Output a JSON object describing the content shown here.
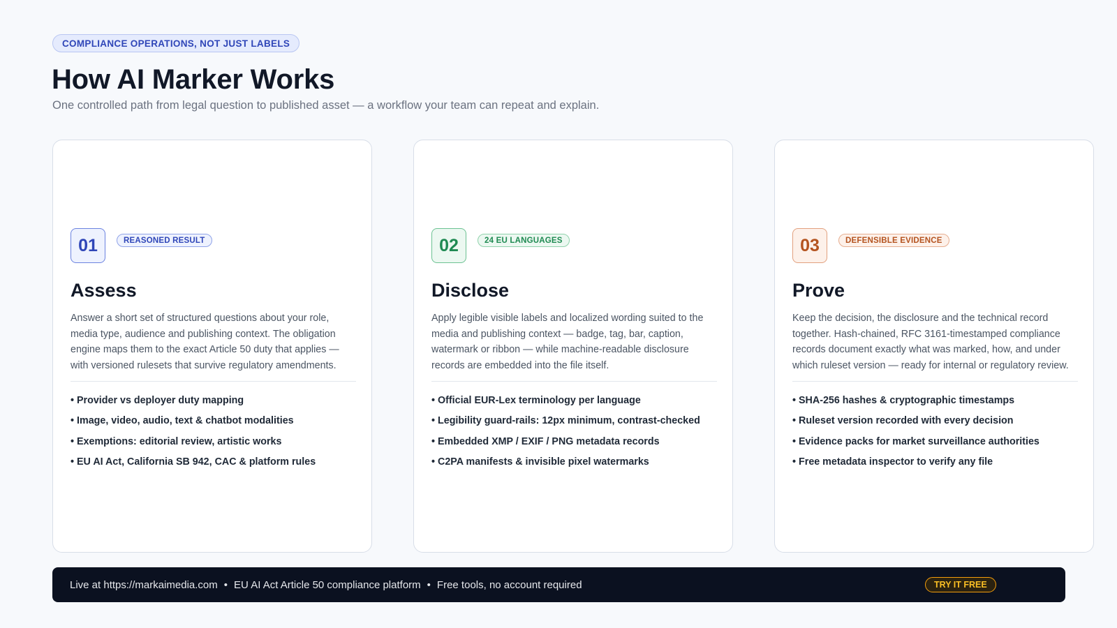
{
  "header": {
    "eyebrow": "COMPLIANCE OPERATIONS, NOT JUST LABELS",
    "title": "How AI Marker Works",
    "subtitle": "One controlled path from legal question to published asset — a workflow your team can repeat and explain."
  },
  "cards": [
    {
      "number": "01",
      "tag": "REASONED RESULT",
      "title": "Assess",
      "description": "Answer a short set of structured questions about your role, media type, audience and publishing context. The obligation engine maps them to the exact Article 50 duty that applies — with versioned rulesets that survive regulatory amendments.",
      "features": [
        "Provider vs deployer duty mapping",
        "Image, video, audio, text & chatbot modalities",
        "Exemptions: editorial review, artistic works",
        "EU AI Act, California SB 942, CAC & platform rules"
      ]
    },
    {
      "number": "02",
      "tag": "24 EU LANGUAGES",
      "title": "Disclose",
      "description": "Apply legible visible labels and localized wording suited to the media and publishing context — badge, tag, bar, caption, watermark or ribbon — while machine-readable disclosure records are embedded into the file itself.",
      "features": [
        "Official EUR-Lex terminology per language",
        "Legibility guard-rails: 12px minimum, contrast-checked",
        "Embedded XMP / EXIF / PNG metadata records",
        "C2PA manifests & invisible pixel watermarks"
      ]
    },
    {
      "number": "03",
      "tag": "DEFENSIBLE EVIDENCE",
      "title": "Prove",
      "description": "Keep the decision, the disclosure and the technical record together. Hash-chained, RFC 3161-timestamped compliance records document exactly what was marked, how, and under which ruleset version — ready for internal or regulatory review.",
      "features": [
        "SHA-256 hashes & cryptographic timestamps",
        "Ruleset version recorded with every decision",
        "Evidence packs for market surveillance authorities",
        "Free metadata inspector to verify any file"
      ]
    }
  ],
  "footer": {
    "url_text": "Live at https://markaimedia.com",
    "separator": "•",
    "platform_text": "EU AI Act Article 50 compliance platform",
    "tools_text": "Free tools, no account required",
    "cta_label": "TRY IT FREE"
  },
  "colors": {
    "blue_accent": "#2f46b8",
    "green_accent": "#1f8a52",
    "orange_accent": "#b4531f",
    "cta_accent": "#f59e0b",
    "footer_bg": "#0b1120"
  }
}
